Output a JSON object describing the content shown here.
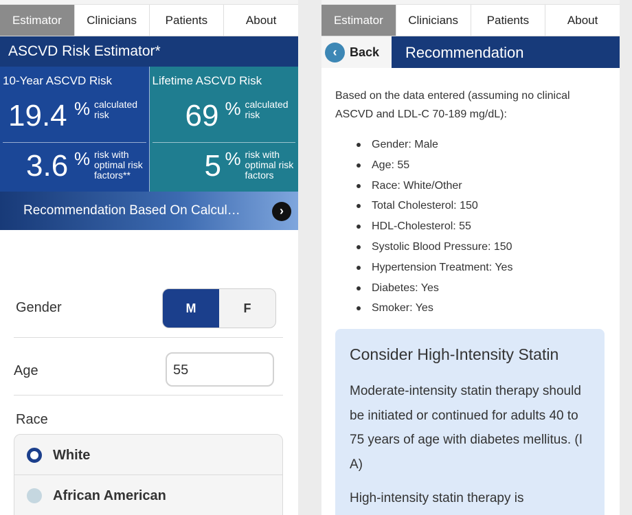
{
  "tabs": [
    "Estimator",
    "Clinicians",
    "Patients",
    "About"
  ],
  "left": {
    "header": "ASCVD Risk Estimator*",
    "ten_year": {
      "title": "10-Year ASCVD Risk",
      "value": "19.4",
      "unit": "%",
      "value_note": "calculated risk",
      "optimal_value": "3.6",
      "optimal_note": "risk with optimal risk factors**"
    },
    "lifetime": {
      "title": "Lifetime ASCVD Risk",
      "value": "69",
      "unit": "%",
      "value_note": "calculated risk",
      "optimal_value": "5",
      "optimal_note": "risk with optimal risk factors"
    },
    "recommendation_link": "Recommendation Based On Calcul…",
    "gender": {
      "label": "Gender",
      "options": [
        "M",
        "F"
      ],
      "selected": "M"
    },
    "age": {
      "label": "Age",
      "value": "55"
    },
    "race": {
      "label": "Race",
      "options": [
        "White",
        "African American"
      ],
      "selected": "White"
    }
  },
  "right": {
    "back_label": "Back",
    "title": "Recommendation",
    "intro": "Based on the data entered (assuming no clinical ASCVD and LDL-C 70-189 mg/dL):",
    "items": [
      "Gender: Male",
      "Age: 55",
      "Race: White/Other",
      "Total Cholesterol: 150",
      "HDL-Cholesterol: 55",
      "Systolic Blood Pressure: 150",
      "Hypertension Treatment: Yes",
      "Diabetes: Yes",
      "Smoker: Yes"
    ],
    "card": {
      "title": "Consider High-Intensity Statin",
      "para1": "Moderate-intensity statin therapy should be initiated or continued for adults 40 to 75 years of age with diabetes mellitus. (I A)",
      "para2": "High-intensity statin therapy is"
    }
  },
  "colors": {
    "header_navy": "#173a7a",
    "ten_year_blue": "#1b4797",
    "lifetime_teal": "#1f7d90",
    "card_bg": "#dde9f9",
    "active_tab": "#8b8b8b"
  },
  "icons": {
    "rec_arrow": "chevron-right-icon",
    "back": "chevron-left-icon"
  }
}
